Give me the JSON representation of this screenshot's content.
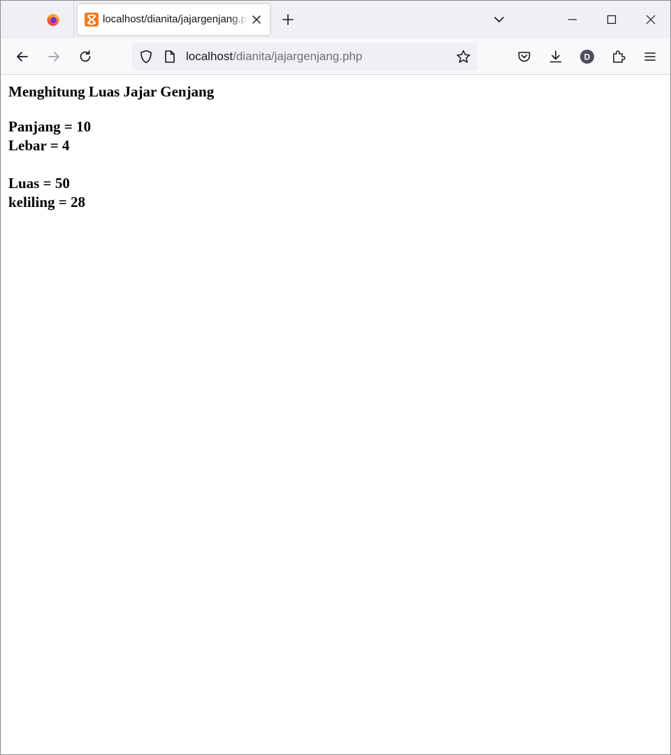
{
  "browser": {
    "tab": {
      "title": "localhost/dianita/jajargenjang.php"
    },
    "urlbar": {
      "host": "localhost",
      "path": "/dianita/jajargenjang.php"
    },
    "profile_initial": "D",
    "colors": {
      "tabstrip_bg": "#f0f0f4",
      "navbar_bg": "#f9f9fb",
      "favicon_orange": "#f07b22"
    }
  },
  "page": {
    "heading": "Menghitung Luas Jajar Genjang",
    "panjang": "Panjang = 10",
    "lebar": "Lebar = 4",
    "luas": "Luas = 50",
    "keliling": "keliling = 28"
  }
}
